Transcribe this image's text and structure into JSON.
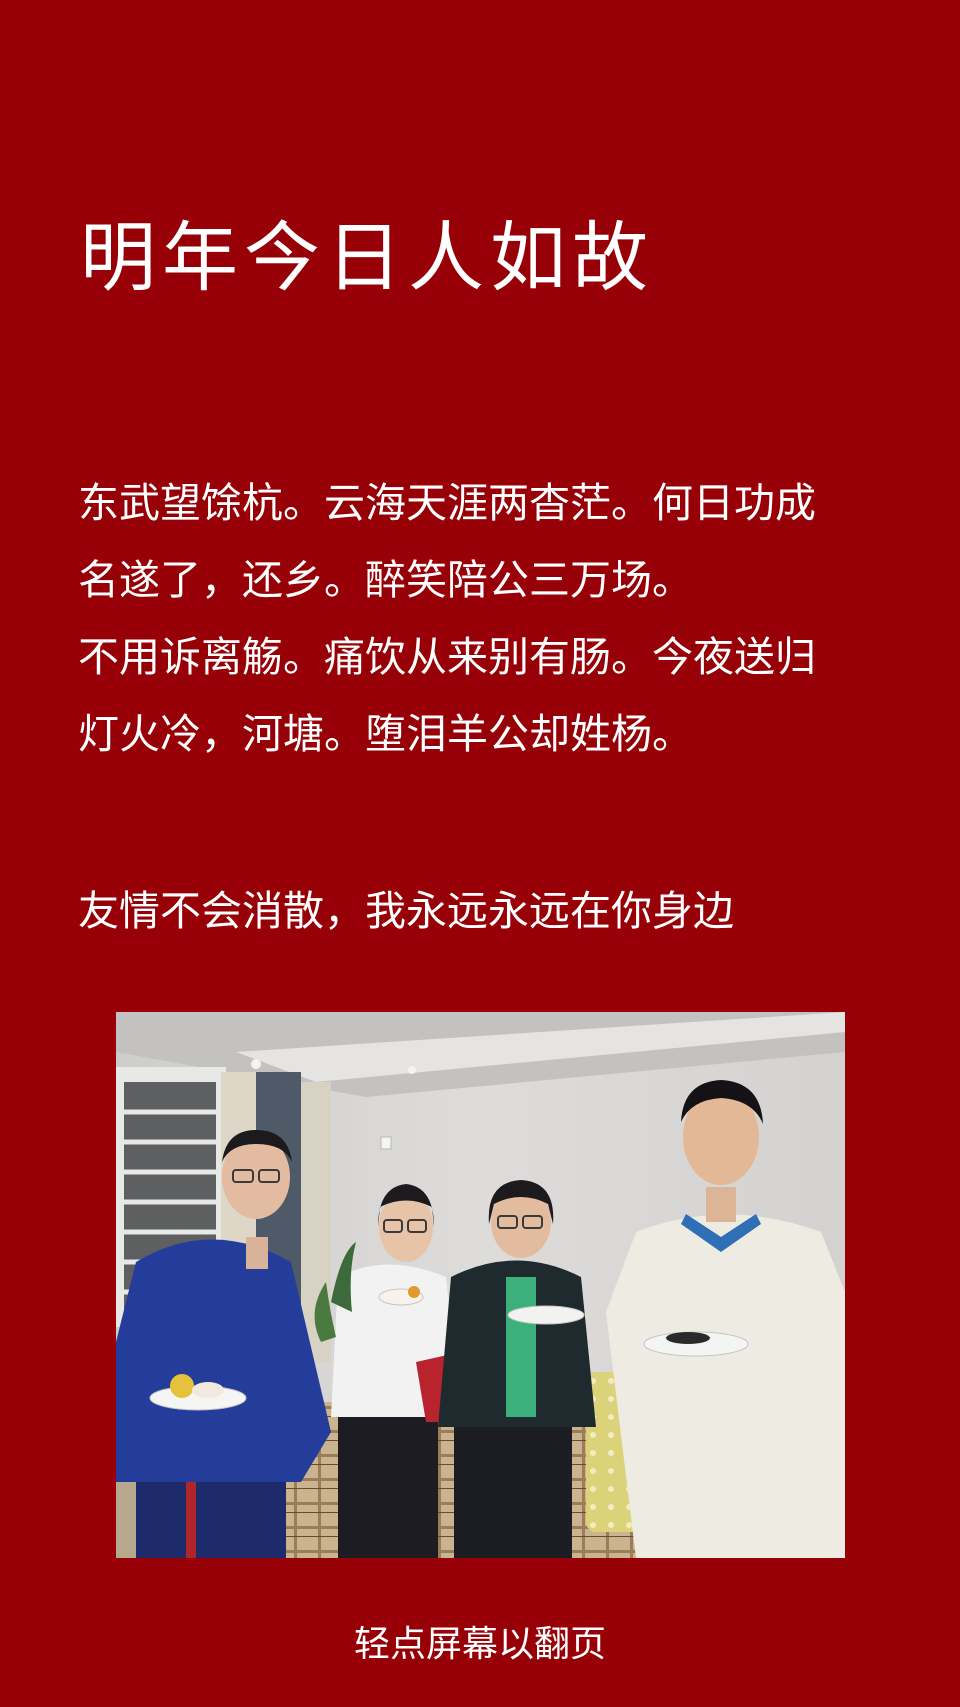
{
  "title": "明年今日人如故",
  "poem": {
    "lines": [
      "东武望馀杭。云海天涯两杳茫。何日功成",
      "名遂了，还乡。醉笑陪公三万场。",
      "不用诉离觞。痛饮从来别有肠。今夜送归",
      "灯火冷，河塘。堕泪羊公却姓杨。"
    ]
  },
  "dedication": "友情不会消散，我永远永远在你身边",
  "tap_hint": "轻点屏幕以翻页",
  "colors": {
    "background": "#960006",
    "text": "#ffffff"
  }
}
